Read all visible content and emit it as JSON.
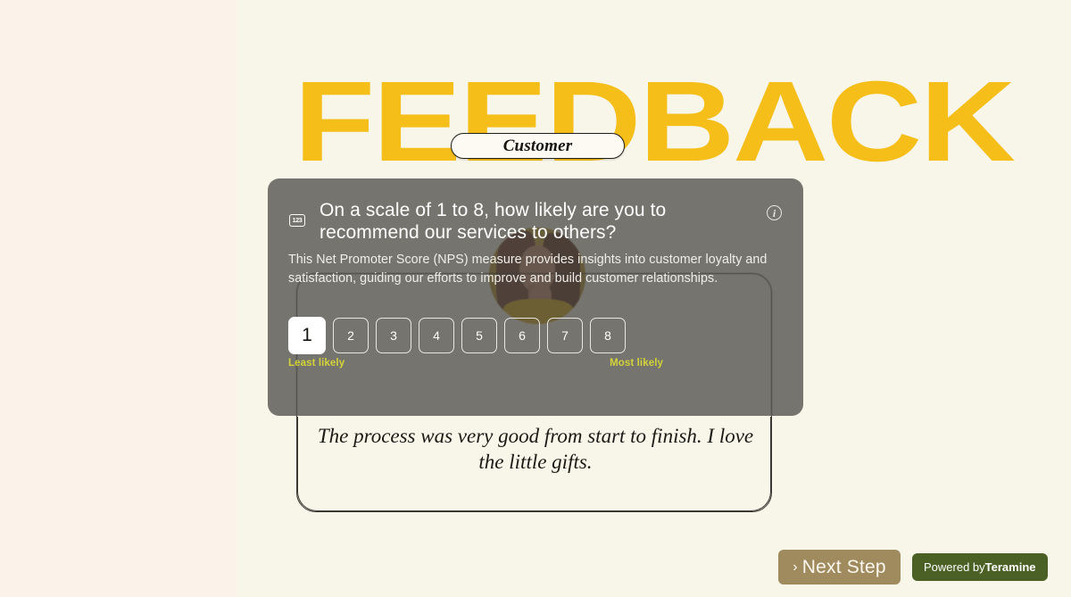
{
  "theme": {
    "bg_left": "#FBF2EA",
    "bg_right": "#F8F5E9",
    "headline_yellow": "#F5BE18",
    "panel_gray": "#666662",
    "scale_label_yellow": "#D2D23A",
    "next_step_tan": "#A08B5F",
    "badge_green": "#4A6024"
  },
  "header": {
    "headline": "FEEDBACK",
    "pill_label": "Customer"
  },
  "question": {
    "number_icon_label": "123",
    "info_icon_glyph": "i",
    "title": "On a scale of 1 to 8, how likely are you to recommend our services to others?",
    "description": "This Net Promoter Score (NPS) measure provides insights into customer loyalty and satisfaction, guiding our efforts to improve and build customer relationships.",
    "scale": {
      "options": [
        "1",
        "2",
        "3",
        "4",
        "5",
        "6",
        "7",
        "8"
      ],
      "selected": "1",
      "min_label": "Least likely",
      "max_label": "Most likely"
    }
  },
  "testimonial": {
    "quote": "The process was very good from start to finish. I love the little gifts."
  },
  "footer": {
    "next_step_chevron": "›",
    "next_step_label": "Next Step",
    "powered_prefix": "Powered by",
    "powered_brand": "Teramine"
  }
}
